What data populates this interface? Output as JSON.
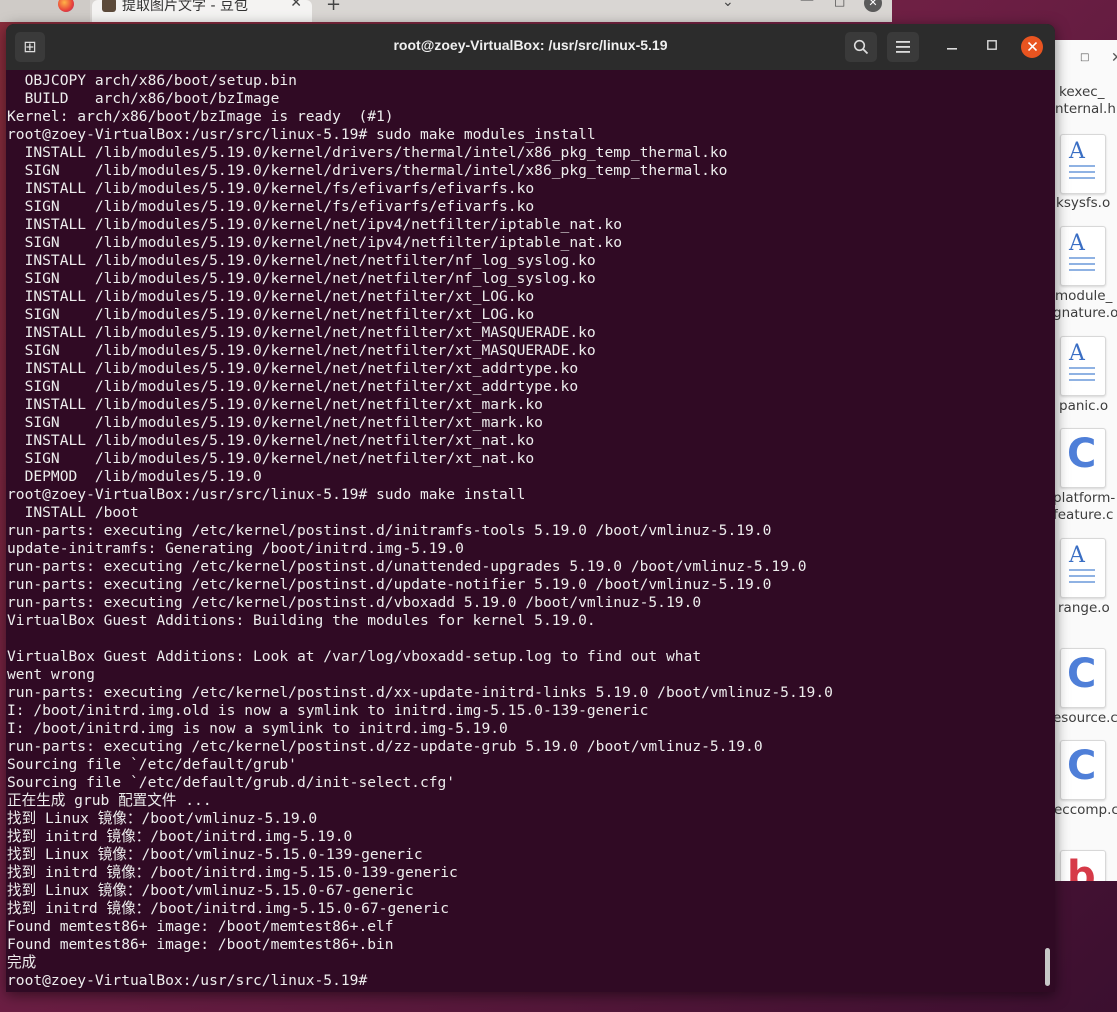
{
  "browser": {
    "tab_title": "提取图片文字 - 豆包",
    "tab_close": "✕",
    "new_tab": "+",
    "chevron": "⌄",
    "minimize": "—",
    "maximize": "□",
    "close": "✕"
  },
  "terminal": {
    "title": "root@zoey-VirtualBox: /usr/src/linux-5.19",
    "lines": [
      "  OBJCOPY arch/x86/boot/setup.bin",
      "  BUILD   arch/x86/boot/bzImage",
      "Kernel: arch/x86/boot/bzImage is ready  (#1)",
      "root@zoey-VirtualBox:/usr/src/linux-5.19# sudo make modules_install",
      "  INSTALL /lib/modules/5.19.0/kernel/drivers/thermal/intel/x86_pkg_temp_thermal.ko",
      "  SIGN    /lib/modules/5.19.0/kernel/drivers/thermal/intel/x86_pkg_temp_thermal.ko",
      "  INSTALL /lib/modules/5.19.0/kernel/fs/efivarfs/efivarfs.ko",
      "  SIGN    /lib/modules/5.19.0/kernel/fs/efivarfs/efivarfs.ko",
      "  INSTALL /lib/modules/5.19.0/kernel/net/ipv4/netfilter/iptable_nat.ko",
      "  SIGN    /lib/modules/5.19.0/kernel/net/ipv4/netfilter/iptable_nat.ko",
      "  INSTALL /lib/modules/5.19.0/kernel/net/netfilter/nf_log_syslog.ko",
      "  SIGN    /lib/modules/5.19.0/kernel/net/netfilter/nf_log_syslog.ko",
      "  INSTALL /lib/modules/5.19.0/kernel/net/netfilter/xt_LOG.ko",
      "  SIGN    /lib/modules/5.19.0/kernel/net/netfilter/xt_LOG.ko",
      "  INSTALL /lib/modules/5.19.0/kernel/net/netfilter/xt_MASQUERADE.ko",
      "  SIGN    /lib/modules/5.19.0/kernel/net/netfilter/xt_MASQUERADE.ko",
      "  INSTALL /lib/modules/5.19.0/kernel/net/netfilter/xt_addrtype.ko",
      "  SIGN    /lib/modules/5.19.0/kernel/net/netfilter/xt_addrtype.ko",
      "  INSTALL /lib/modules/5.19.0/kernel/net/netfilter/xt_mark.ko",
      "  SIGN    /lib/modules/5.19.0/kernel/net/netfilter/xt_mark.ko",
      "  INSTALL /lib/modules/5.19.0/kernel/net/netfilter/xt_nat.ko",
      "  SIGN    /lib/modules/5.19.0/kernel/net/netfilter/xt_nat.ko",
      "  DEPMOD  /lib/modules/5.19.0",
      "root@zoey-VirtualBox:/usr/src/linux-5.19# sudo make install",
      "  INSTALL /boot",
      "run-parts: executing /etc/kernel/postinst.d/initramfs-tools 5.19.0 /boot/vmlinuz-5.19.0",
      "update-initramfs: Generating /boot/initrd.img-5.19.0",
      "run-parts: executing /etc/kernel/postinst.d/unattended-upgrades 5.19.0 /boot/vmlinuz-5.19.0",
      "run-parts: executing /etc/kernel/postinst.d/update-notifier 5.19.0 /boot/vmlinuz-5.19.0",
      "run-parts: executing /etc/kernel/postinst.d/vboxadd 5.19.0 /boot/vmlinuz-5.19.0",
      "VirtualBox Guest Additions: Building the modules for kernel 5.19.0.",
      "",
      "VirtualBox Guest Additions: Look at /var/log/vboxadd-setup.log to find out what",
      "went wrong",
      "run-parts: executing /etc/kernel/postinst.d/xx-update-initrd-links 5.19.0 /boot/vmlinuz-5.19.0",
      "I: /boot/initrd.img.old is now a symlink to initrd.img-5.15.0-139-generic",
      "I: /boot/initrd.img is now a symlink to initrd.img-5.19.0",
      "run-parts: executing /etc/kernel/postinst.d/zz-update-grub 5.19.0 /boot/vmlinuz-5.19.0",
      "Sourcing file `/etc/default/grub'",
      "Sourcing file `/etc/default/grub.d/init-select.cfg'",
      "正在生成 grub 配置文件 ...",
      "找到 Linux 镜像：/boot/vmlinuz-5.19.0",
      "找到 initrd 镜像：/boot/initrd.img-5.19.0",
      "找到 Linux 镜像：/boot/vmlinuz-5.15.0-139-generic",
      "找到 initrd 镜像：/boot/initrd.img-5.15.0-139-generic",
      "找到 Linux 镜像：/boot/vmlinuz-5.15.0-67-generic",
      "找到 initrd 镜像：/boot/initrd.img-5.15.0-67-generic",
      "Found memtest86+ image: /boot/memtest86+.elf",
      "Found memtest86+ image: /boot/memtest86+.bin",
      "完成",
      "root@zoey-VirtualBox:/usr/src/linux-5.19# "
    ]
  },
  "file_manager": {
    "items": [
      {
        "name_lines": [
          "kexec_",
          "nternal.h"
        ],
        "icon": "header-file-icon"
      },
      {
        "name_lines": [
          "ksysfs.o"
        ],
        "icon": "document-icon"
      },
      {
        "name_lines": [
          "module_",
          "gnature.o"
        ],
        "icon": "document-icon"
      },
      {
        "name_lines": [
          "panic.o"
        ],
        "icon": "document-icon"
      },
      {
        "name_lines": [
          "platform-",
          "feature.c"
        ],
        "icon": "c-source-icon"
      },
      {
        "name_lines": [
          "range.o"
        ],
        "icon": "document-icon"
      },
      {
        "name_lines": [
          "esource.c"
        ],
        "icon": "c-source-icon"
      },
      {
        "name_lines": [
          "eccomp.c"
        ],
        "icon": "c-source-icon"
      }
    ]
  }
}
